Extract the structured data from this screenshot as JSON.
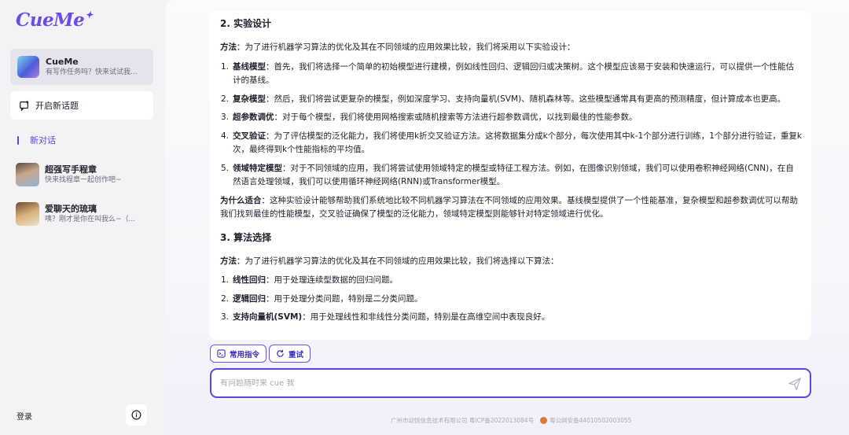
{
  "sidebar": {
    "logo": "CueMe",
    "assistant": {
      "name": "CueMe",
      "subtitle": "有写作任务吗？快来试试我..."
    },
    "new_topic": "开启新话题",
    "section_label": "新对话",
    "chats": [
      {
        "name": "超强写手程章",
        "subtitle": "快来找程章一起创作吧~"
      },
      {
        "name": "爱聊天的琉璃",
        "subtitle": "咦？刚才是你在叫我么~（..."
      }
    ],
    "login": "登录"
  },
  "content": {
    "heading1": "2. 实验设计",
    "method1_label": "方法",
    "method1_text": "：为了进行机器学习算法的优化及其在不同领域的应用效果比较，我们将采用以下实验设计：",
    "list1": [
      {
        "num": "1.",
        "label": "基线模型",
        "text": "：首先，我们将选择一个简单的初始模型进行建模，例如线性回归、逻辑回归或决策树。这个模型应该易于安装和快速运行，可以提供一个性能估计的基线。"
      },
      {
        "num": "2.",
        "label": "复杂模型",
        "text": "：然后，我们将尝试更复杂的模型，例如深度学习、支持向量机(SVM)、随机森林等。这些模型通常具有更高的预测精度，但计算成本也更高。"
      },
      {
        "num": "3.",
        "label": "超参数调优",
        "text": "：对于每个模型，我们将使用网格搜索或随机搜索等方法进行超参数调优，以找到最佳的性能参数。"
      },
      {
        "num": "4.",
        "label": "交叉验证",
        "text": "：为了评估模型的泛化能力，我们将使用k折交叉验证方法。这将数据集分成k个部分，每次使用其中k-1个部分进行训练，1个部分进行验证，重复k次，最终得到k个性能指标的平均值。"
      },
      {
        "num": "5.",
        "label": "领域特定模型",
        "text": "：对于不同领域的应用，我们将尝试使用领域特定的模型或特征工程方法。例如，在图像识别领域，我们可以使用卷积神经网络(CNN)，在自然语言处理领域，我们可以使用循环神经网络(RNN)或Transformer模型。"
      }
    ],
    "why_label": "为什么适合",
    "why_text": "：这种实验设计能够帮助我们系统地比较不同机器学习算法在不同领域的应用效果。基线模型提供了一个性能基准，复杂模型和超参数调优可以帮助我们找到最佳的性能模型，交叉验证确保了模型的泛化能力，领域特定模型则能够针对特定领域进行优化。",
    "heading2": "3. 算法选择",
    "method2_label": "方法",
    "method2_text": "：为了进行机器学习算法的优化及其在不同领域的应用效果比较，我们将选择以下算法：",
    "list2": [
      {
        "num": "1.",
        "label": "线性回归",
        "text": "：用于处理连续型数据的回归问题。"
      },
      {
        "num": "2.",
        "label": "逻辑回归",
        "text": "：用于处理分类问题，特别是二分类问题。"
      },
      {
        "num": "3.",
        "label": "支持向量机(SVM)",
        "text": "：用于处理线性和非线性分类问题，特别是在高维空间中表现良好。"
      }
    ]
  },
  "actions": {
    "common_commands": "常用指令",
    "retry": "重试"
  },
  "input": {
    "placeholder": "有问题随时来 cue 我"
  },
  "footer": {
    "company": "广州市动悦信息技术有限公司 粤ICP备2022013084号",
    "police": "粤公网安备44010502003055"
  },
  "colors": {
    "accent": "#5a47e0",
    "logo": "#6b4de6"
  }
}
